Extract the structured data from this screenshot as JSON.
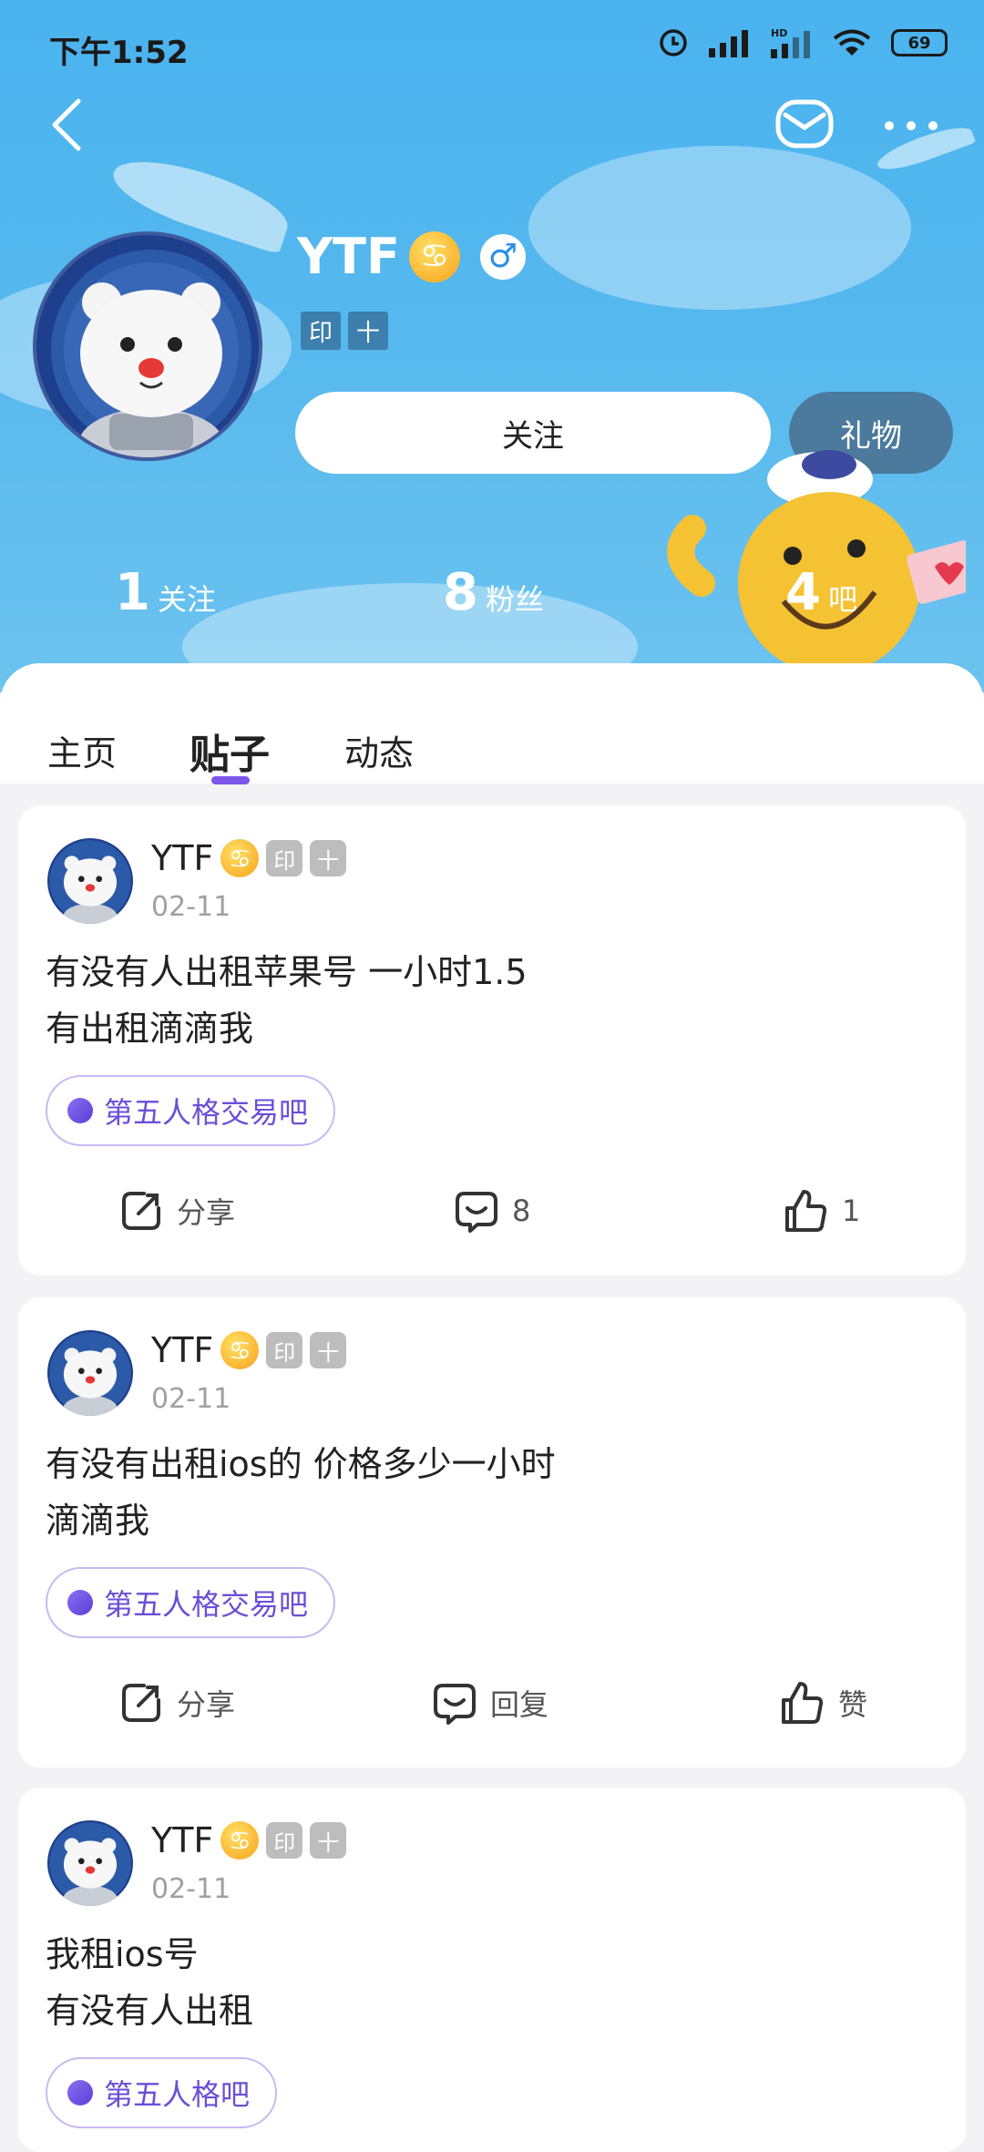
{
  "status": {
    "time": "下午1:52",
    "battery": "69"
  },
  "profile": {
    "username": "YTF",
    "zodiac_symbol": "♋",
    "gender_symbol": "♂",
    "tags": [
      "印",
      "十"
    ],
    "follow_label": "关注",
    "gift_label": "礼物",
    "stats": [
      {
        "num": "1",
        "label": "关注"
      },
      {
        "num": "8",
        "label": "粉丝"
      },
      {
        "num": "4",
        "label": "吧"
      }
    ]
  },
  "tabs": [
    "主页",
    "贴子",
    "动态"
  ],
  "active_tab": "贴子",
  "posts": [
    {
      "author": "YTF",
      "zodiac": "♋",
      "tags": [
        "印",
        "十"
      ],
      "date": "02-11",
      "lines": [
        "有没有人出租苹果号 一小时1.5",
        "有出租滴滴我"
      ],
      "forum": "第五人格交易吧",
      "share": "分享",
      "comment": "8",
      "like": "1"
    },
    {
      "author": "YTF",
      "zodiac": "♋",
      "tags": [
        "印",
        "十"
      ],
      "date": "02-11",
      "lines": [
        "有没有出租ios的 价格多少一小时",
        "滴滴我"
      ],
      "forum": "第五人格交易吧",
      "share": "分享",
      "comment": "回复",
      "like": "赞"
    },
    {
      "author": "YTF",
      "zodiac": "♋",
      "tags": [
        "印",
        "十"
      ],
      "date": "02-11",
      "lines": [
        "我租ios号",
        "有没有人出租"
      ],
      "forum": "第五人格吧"
    }
  ],
  "colors": {
    "accent": "#7a55ea",
    "header_bg": "#4ab3ef"
  }
}
